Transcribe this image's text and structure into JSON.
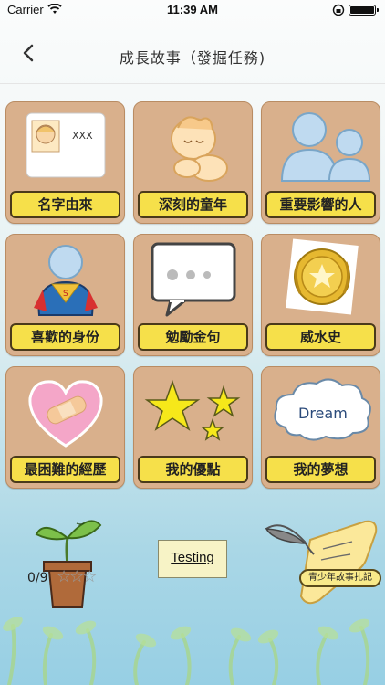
{
  "status_bar": {
    "carrier": "Carrier",
    "time": "11:39 AM"
  },
  "nav": {
    "title": "成長故事（發掘任務)"
  },
  "tiles": [
    {
      "label": "名字由來",
      "art_text": "XXX",
      "icon": "name-card-icon"
    },
    {
      "label": "深刻的童年",
      "icon": "baby-icon"
    },
    {
      "label": "重要影響的人",
      "icon": "people-icon"
    },
    {
      "label": "喜歡的身份",
      "icon": "superhero-icon"
    },
    {
      "label": "勉勵金句",
      "icon": "speech-bubble-icon"
    },
    {
      "label": "威水史",
      "icon": "medal-icon"
    },
    {
      "label": "最困難的經歷",
      "icon": "bandaged-heart-icon"
    },
    {
      "label": "我的優點",
      "icon": "stars-icon"
    },
    {
      "label": "我的夢想",
      "icon": "dream-cloud-icon",
      "art_text": "Dream"
    }
  ],
  "bottom": {
    "progress": "0/9",
    "stars_filled": 0,
    "stars_total": 3,
    "testing_label": "Testing",
    "journal_label": "青少年故事扎記"
  }
}
